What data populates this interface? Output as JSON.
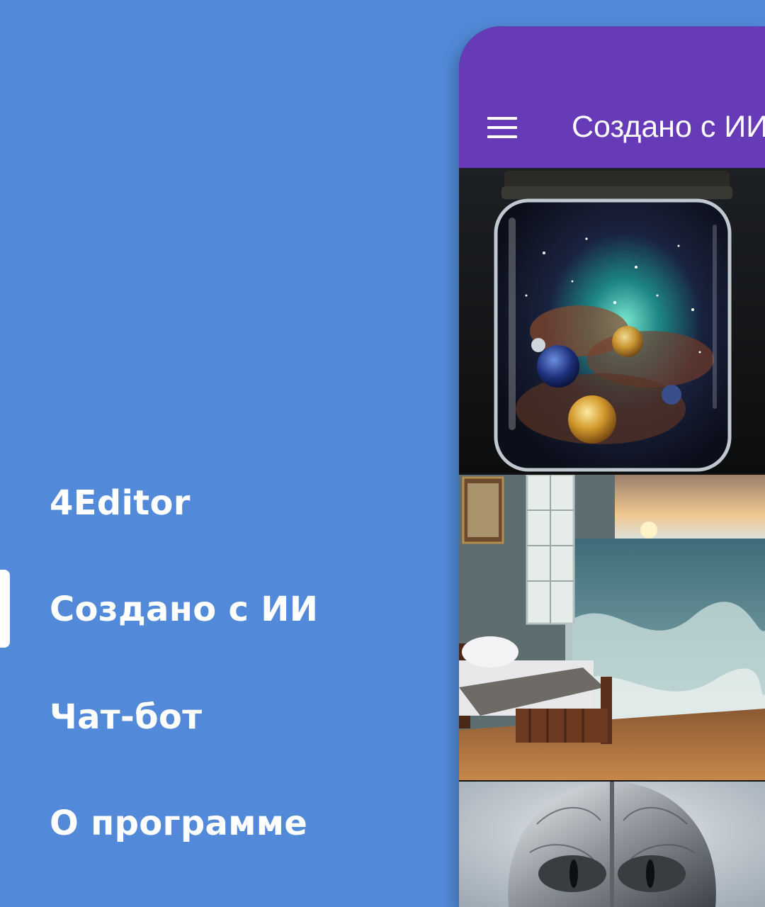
{
  "drawer": {
    "items": [
      {
        "label": "4Editor",
        "active": false
      },
      {
        "label": "Создано с ИИ",
        "active": true
      },
      {
        "label": "Чат-бот",
        "active": false
      },
      {
        "label": "О программе",
        "active": false
      }
    ]
  },
  "app_bar": {
    "title": "Создано с ИИ",
    "menu_icon": "hamburger-menu-icon"
  },
  "gallery": {
    "images": [
      {
        "subject": "galaxy-in-jar"
      },
      {
        "subject": "bedroom-ocean-waves"
      },
      {
        "subject": "metal-cat-helmet"
      }
    ]
  },
  "colors": {
    "drawer_background": "#528ad9",
    "app_bar": "#673ab7",
    "menu_text": "#ffffff"
  }
}
